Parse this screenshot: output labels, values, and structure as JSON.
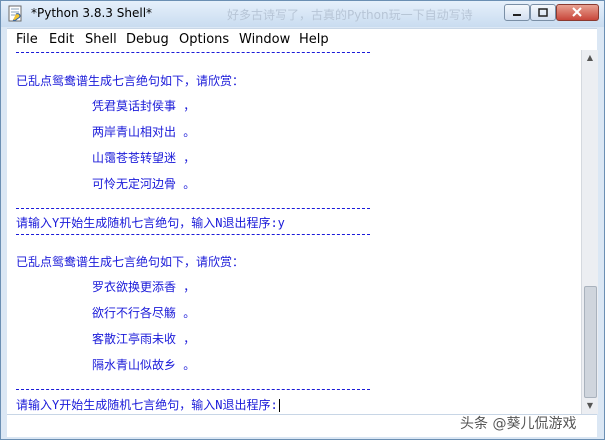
{
  "window": {
    "title": "*Python 3.8.3 Shell*",
    "overlay_title": "好多古诗写了，古真的Python玩一下自动写诗"
  },
  "menu": [
    "File",
    "Edit",
    "Shell",
    "Debug",
    "Options",
    "Window",
    "Help"
  ],
  "shell": {
    "separator": "--------------------------------------------------------------------",
    "block1_intro": "已乱点鸳鸯谱生成七言绝句如下，请欣赏：",
    "block1_lines": [
      "凭君莫话封侯事 ，",
      "两岸青山相对出 。",
      "山霭苍苍转望迷 ，",
      "可怜无定河边骨 。"
    ],
    "prompt1": "请输入Y开始生成随机七言绝句，输入N退出程序:y",
    "block2_intro": "已乱点鸳鸯谱生成七言绝句如下，请欣赏：",
    "block2_lines": [
      "罗衣欲换更添香 ，",
      "欲行不行各尽觞 。",
      "客散江亭雨未收 ，",
      "隔水青山似故乡 。"
    ],
    "prompt2": "请输入Y开始生成随机七言绝句，输入N退出程序:"
  },
  "watermark": "头条 @葵儿侃游戏"
}
